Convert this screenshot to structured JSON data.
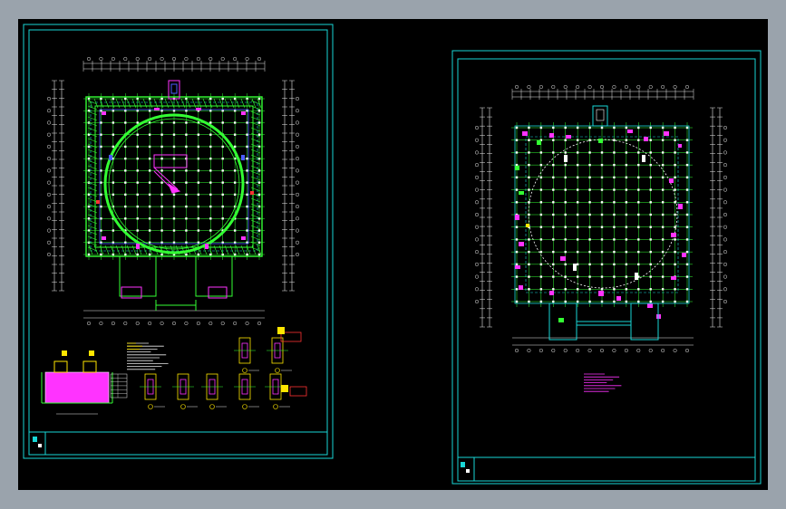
{
  "view": {
    "background_color": "#000000",
    "frame_color": "#9aa3ac"
  },
  "colors": {
    "border": "#19d6d6",
    "grid": "#33ff33",
    "dim": "#e8e8e8",
    "column": "#ffffff",
    "ring": "#33ff33",
    "accent_magenta": "#ff33ff",
    "accent_yellow": "#ffe600",
    "accent_blue": "#4b5cff",
    "accent_red": "#ff3333"
  },
  "sheets": [
    {
      "id": "sheet-left",
      "name": "structural-plan-with-details",
      "icons": [
        "title-block-icon",
        "floor-plan-icon",
        "detail-sections-icon",
        "notes-icon"
      ]
    },
    {
      "id": "sheet-right",
      "name": "structural-plan",
      "icons": [
        "title-block-icon",
        "floor-plan-icon",
        "notes-icon"
      ]
    }
  ]
}
